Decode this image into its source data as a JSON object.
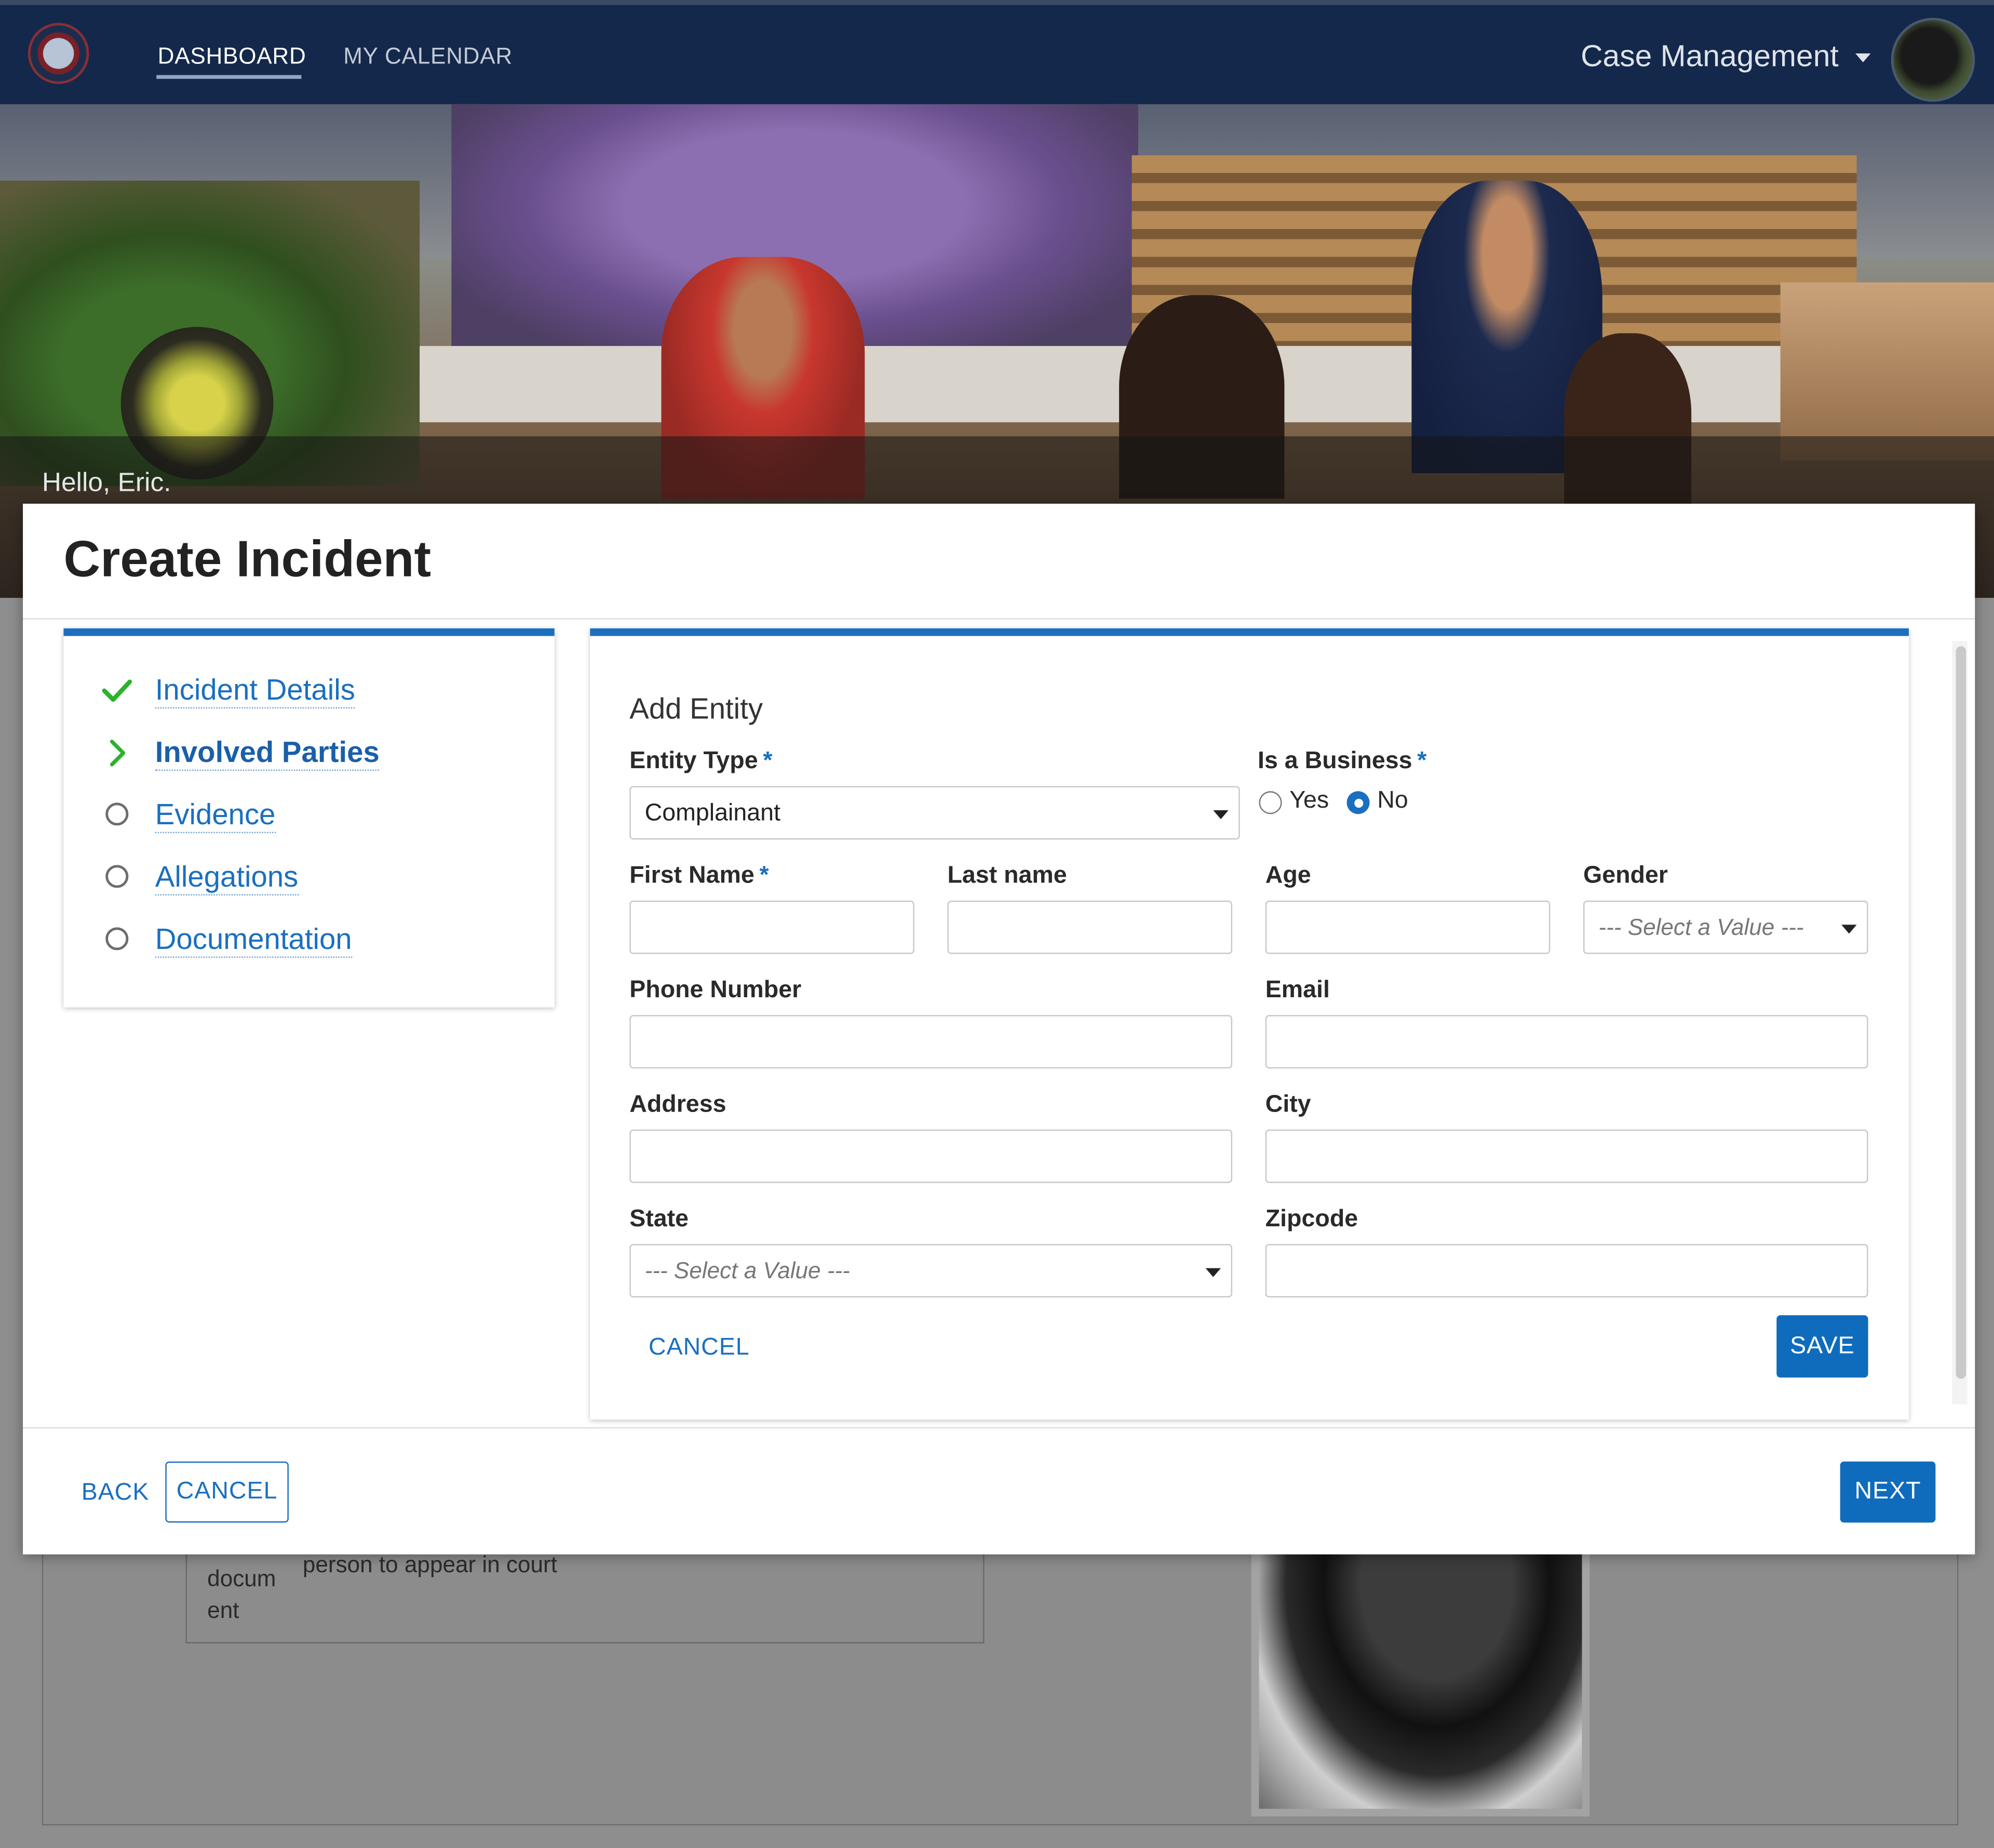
{
  "nav": {
    "tabs": [
      {
        "label": "DASHBOARD",
        "active": true
      },
      {
        "label": "MY CALENDAR",
        "active": false
      }
    ],
    "app_menu_label": "Case Management"
  },
  "hero": {
    "greeting": "Hello, Eric."
  },
  "background_page": {
    "text_a": "docum",
    "text_b": "ent",
    "text_c": "person to appear in court"
  },
  "modal": {
    "title": "Create Incident",
    "steps": [
      {
        "label": "Incident Details",
        "status": "complete",
        "icon": "check-icon"
      },
      {
        "label": "Involved Parties",
        "status": "current",
        "icon": "chevron-right-icon"
      },
      {
        "label": "Evidence",
        "status": "pending",
        "icon": "circle-icon"
      },
      {
        "label": "Allegations",
        "status": "pending",
        "icon": "circle-icon"
      },
      {
        "label": "Documentation",
        "status": "pending",
        "icon": "circle-icon"
      }
    ],
    "form": {
      "section_title": "Add Entity",
      "required_marker": "*",
      "entity_type": {
        "label": "Entity Type",
        "value": "Complainant"
      },
      "is_business": {
        "label": "Is a Business",
        "options": [
          "Yes",
          "No"
        ],
        "selected": "No"
      },
      "first_name": {
        "label": "First Name",
        "value": ""
      },
      "last_name": {
        "label": "Last name",
        "value": ""
      },
      "age": {
        "label": "Age",
        "value": ""
      },
      "gender": {
        "label": "Gender",
        "placeholder": "--- Select a Value ---"
      },
      "phone": {
        "label": "Phone Number",
        "value": ""
      },
      "email": {
        "label": "Email",
        "value": ""
      },
      "address": {
        "label": "Address",
        "value": ""
      },
      "city": {
        "label": "City",
        "value": ""
      },
      "state": {
        "label": "State",
        "placeholder": "--- Select a Value ---"
      },
      "zipcode": {
        "label": "Zipcode",
        "value": ""
      },
      "cancel_label": "CANCEL",
      "save_label": "SAVE"
    },
    "footer": {
      "back_label": "BACK",
      "cancel_label": "CANCEL",
      "next_label": "NEXT"
    }
  },
  "colors": {
    "nav_bg": "#13284a",
    "accent": "#1a6fbf",
    "primary_button": "#0f6cbd",
    "complete_green": "#2bb32b"
  }
}
